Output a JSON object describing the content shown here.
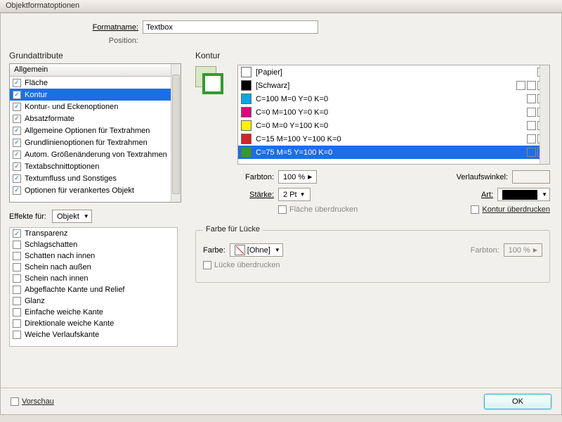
{
  "window": {
    "title": "Objektformatoptionen"
  },
  "header": {
    "formatname_label": "Formatname:",
    "formatname_value": "Textbox",
    "position_label": "Position:"
  },
  "left": {
    "section_title": "Grundattribute",
    "header": "Allgemein",
    "items": [
      {
        "label": "Fläche",
        "checked": true,
        "selected": false
      },
      {
        "label": "Kontur",
        "checked": true,
        "selected": true
      },
      {
        "label": "Kontur- und Eckenoptionen",
        "checked": true,
        "selected": false
      },
      {
        "label": "Absatzformate",
        "checked": true,
        "selected": false
      },
      {
        "label": "Allgemeine Optionen für Textrahmen",
        "checked": true,
        "selected": false
      },
      {
        "label": "Grundlinienoptionen für Textrahmen",
        "checked": true,
        "selected": false
      },
      {
        "label": "Autom. Größenänderung von Textrahmen",
        "checked": true,
        "selected": false
      },
      {
        "label": "Textabschnittoptionen",
        "checked": true,
        "selected": false
      },
      {
        "label": "Textumfluss und Sonstiges",
        "checked": true,
        "selected": false
      },
      {
        "label": "Optionen für verankertes Objekt",
        "checked": true,
        "selected": false
      }
    ],
    "effects_label": "Effekte für:",
    "effects_target": "Objekt",
    "fx": [
      {
        "label": "Transparenz",
        "checked": true
      },
      {
        "label": "Schlagschatten",
        "checked": false
      },
      {
        "label": "Schatten nach innen",
        "checked": false
      },
      {
        "label": "Schein nach außen",
        "checked": false
      },
      {
        "label": "Schein nach innen",
        "checked": false
      },
      {
        "label": "Abgeflachte Kante und Relief",
        "checked": false
      },
      {
        "label": "Glanz",
        "checked": false
      },
      {
        "label": "Einfache weiche Kante",
        "checked": false
      },
      {
        "label": "Direktionale weiche Kante",
        "checked": false
      },
      {
        "label": "Weiche Verlaufskante",
        "checked": false
      }
    ]
  },
  "right": {
    "section_title": "Kontur",
    "swatches": [
      {
        "name": "[Papier]",
        "color": "#ffffff",
        "selected": false,
        "icons": 1
      },
      {
        "name": "[Schwarz]",
        "color": "#000000",
        "selected": false,
        "icons": 3
      },
      {
        "name": "C=100 M=0 Y=0 K=0",
        "color": "#00a8e6",
        "selected": false,
        "icons": 2
      },
      {
        "name": "C=0 M=100 Y=0 K=0",
        "color": "#e4007f",
        "selected": false,
        "icons": 2
      },
      {
        "name": "C=0 M=0 Y=100 K=0",
        "color": "#fff200",
        "selected": false,
        "icons": 2
      },
      {
        "name": "C=15 M=100 Y=100 K=0",
        "color": "#d2232a",
        "selected": false,
        "icons": 2
      },
      {
        "name": "C=75 M=5 Y=100 K=0",
        "color": "#2f9d2f",
        "selected": true,
        "icons": 2
      }
    ],
    "farbton_label": "Farbton:",
    "farbton_value": "100 %",
    "staerke_label": "Stärke:",
    "staerke_value": "2 Pt",
    "verlaufw_label": "Verlaufswinkel:",
    "verlaufw_value": "",
    "art_label": "Art:",
    "chk_flaeche_label": "Fläche überdrucken",
    "chk_kontur_label": "Kontur überdrucken",
    "gap": {
      "title": "Farbe für Lücke",
      "farbe_label": "Farbe:",
      "farbe_value": "[Ohne]",
      "farbton_label": "Farbton:",
      "farbton_value": "100 %",
      "chk_label": "Lücke überdrucken"
    }
  },
  "footer": {
    "vorschau_label": "Vorschau",
    "ok_label": "OK"
  }
}
